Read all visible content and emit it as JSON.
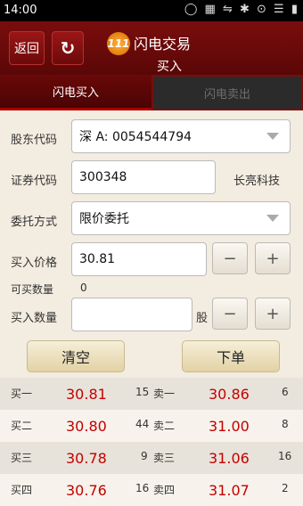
{
  "status": {
    "time": "14:00",
    "icons": "◯ ▦ ⇋ ✱ ⊙ ☰ ▮"
  },
  "header": {
    "back_label": "返回",
    "refresh_icon": "↻",
    "logo_text": "111",
    "app_title": "闪电交易",
    "subtitle": "买入"
  },
  "tabs": {
    "buy": "闪电买入",
    "sell": "闪电卖出"
  },
  "form": {
    "account_label": "股东代码",
    "account_value": "深 A: 0054544794",
    "code_label": "证券代码",
    "code_value": "300348",
    "stock_name": "长亮科技",
    "order_type_label": "委托方式",
    "order_type_value": "限价委托",
    "price_label": "买入价格",
    "price_value": "30.81",
    "available_label": "可买数量",
    "available_value": "0",
    "qty_label": "买入数量",
    "qty_value": "",
    "qty_unit": "股",
    "minus": "−",
    "plus": "+"
  },
  "actions": {
    "clear": "清空",
    "submit": "下单"
  },
  "quotes": [
    {
      "bid_label": "买一",
      "bid_price": "30.81",
      "bid_vol": "15",
      "ask_label": "卖一",
      "ask_price": "30.86",
      "ask_vol": "6"
    },
    {
      "bid_label": "买二",
      "bid_price": "30.80",
      "bid_vol": "44",
      "ask_label": "卖二",
      "ask_price": "31.00",
      "ask_vol": "8"
    },
    {
      "bid_label": "买三",
      "bid_price": "30.78",
      "bid_vol": "9",
      "ask_label": "卖三",
      "ask_price": "31.06",
      "ask_vol": "16"
    },
    {
      "bid_label": "买四",
      "bid_price": "30.76",
      "bid_vol": "16",
      "ask_label": "卖四",
      "ask_price": "31.07",
      "ask_vol": "2"
    }
  ],
  "colors": {
    "brand": "#7a0d0d",
    "price": "#c30000"
  }
}
